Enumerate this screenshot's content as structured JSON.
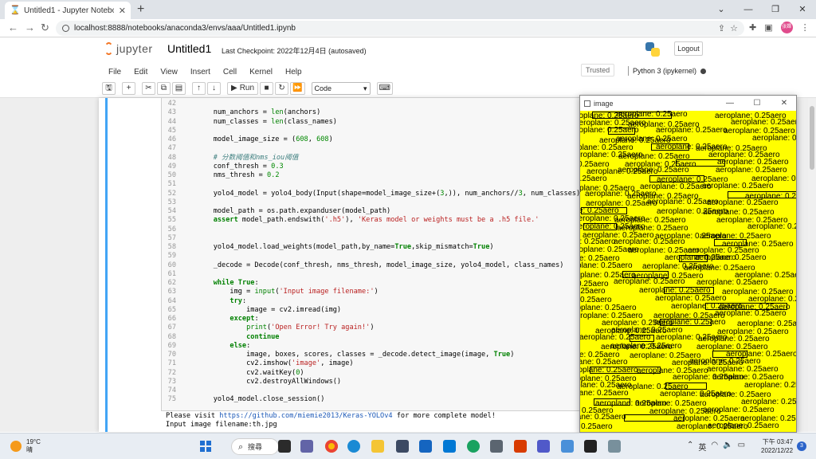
{
  "browser": {
    "tab_title": "Untitled1 - Jupyter Notebook",
    "url": "localhost:8888/notebooks/anaconda3/envs/aaa/Untitled1.ipynb",
    "avatar_text": "张嬋"
  },
  "jupyter": {
    "logo_text": "jupyter",
    "notebook_name": "Untitled1",
    "checkpoint": "Last Checkpoint: 2022年12月4日   (autosaved)",
    "logout_label": "Logout",
    "menu": [
      "File",
      "Edit",
      "View",
      "Insert",
      "Cell",
      "Kernel",
      "Help"
    ],
    "trusted": "Trusted",
    "kernel": "Python 3 (ipykernel)",
    "run_label": "Run",
    "cell_type": "Code"
  },
  "code": {
    "lines": [
      {
        "n": "42",
        "t": ""
      },
      {
        "n": "43",
        "t": "    num_anchors = len(anchors)"
      },
      {
        "n": "44",
        "t": "    num_classes = len(class_names)"
      },
      {
        "n": "45",
        "t": ""
      },
      {
        "n": "46",
        "t": "    model_image_size = (608, 608)"
      },
      {
        "n": "47",
        "t": ""
      },
      {
        "n": "48",
        "t": "    # 分数阈值和nms_iou阈值"
      },
      {
        "n": "49",
        "t": "    conf_thresh = 0.3"
      },
      {
        "n": "50",
        "t": "    nms_thresh = 0.2"
      },
      {
        "n": "51",
        "t": ""
      },
      {
        "n": "52",
        "t": "    yolo4_model = yolo4_body(Input(shape=model_image_size+(3,)), num_anchors//3, num_classes)"
      },
      {
        "n": "53",
        "t": ""
      },
      {
        "n": "54",
        "t": "    model_path = os.path.expanduser(model_path)"
      },
      {
        "n": "55",
        "t": "    assert model_path.endswith('.h5'), 'Keras model or weights must be a .h5 file.'"
      },
      {
        "n": "56",
        "t": ""
      },
      {
        "n": "57",
        "t": ""
      },
      {
        "n": "58",
        "t": "    yolo4_model.load_weights(model_path,by_name=True,skip_mismatch=True)"
      },
      {
        "n": "59",
        "t": ""
      },
      {
        "n": "60",
        "t": "    _decode = Decode(conf_thresh, nms_thresh, model_image_size, yolo4_model, class_names)"
      },
      {
        "n": "61",
        "t": ""
      },
      {
        "n": "62",
        "t": "    while True:"
      },
      {
        "n": "63",
        "t": "        img = input('Input image filename:')"
      },
      {
        "n": "64",
        "t": "        try:"
      },
      {
        "n": "65",
        "t": "            image = cv2.imread(img)"
      },
      {
        "n": "66",
        "t": "        except:"
      },
      {
        "n": "67",
        "t": "            print('Open Error! Try again!')"
      },
      {
        "n": "68",
        "t": "            continue"
      },
      {
        "n": "69",
        "t": "        else:"
      },
      {
        "n": "70",
        "t": "            image, boxes, scores, classes = _decode.detect_image(image, True)"
      },
      {
        "n": "71",
        "t": "            cv2.imshow('image', image)"
      },
      {
        "n": "72",
        "t": "            cv2.waitKey(0)"
      },
      {
        "n": "73",
        "t": "            cv2.destroyAllWindows()"
      },
      {
        "n": "74",
        "t": ""
      },
      {
        "n": "75",
        "t": "    yolo4_model.close_session()"
      }
    ]
  },
  "output": {
    "line1_prefix": "Please visit ",
    "line1_link": "https://github.com/miemie2013/Keras-YOLOv4",
    "line1_suffix": " for more complete model!",
    "line2": "Input image filename:th.jpg"
  },
  "image_window": {
    "title": "image",
    "label": "aeroplane: 0.25"
  },
  "taskbar": {
    "temp": "19°C",
    "weather": "晴",
    "search": "搜尋",
    "ime": "英",
    "time": "下午 03:47",
    "date": "2022/12/22",
    "notif_count": "3"
  }
}
